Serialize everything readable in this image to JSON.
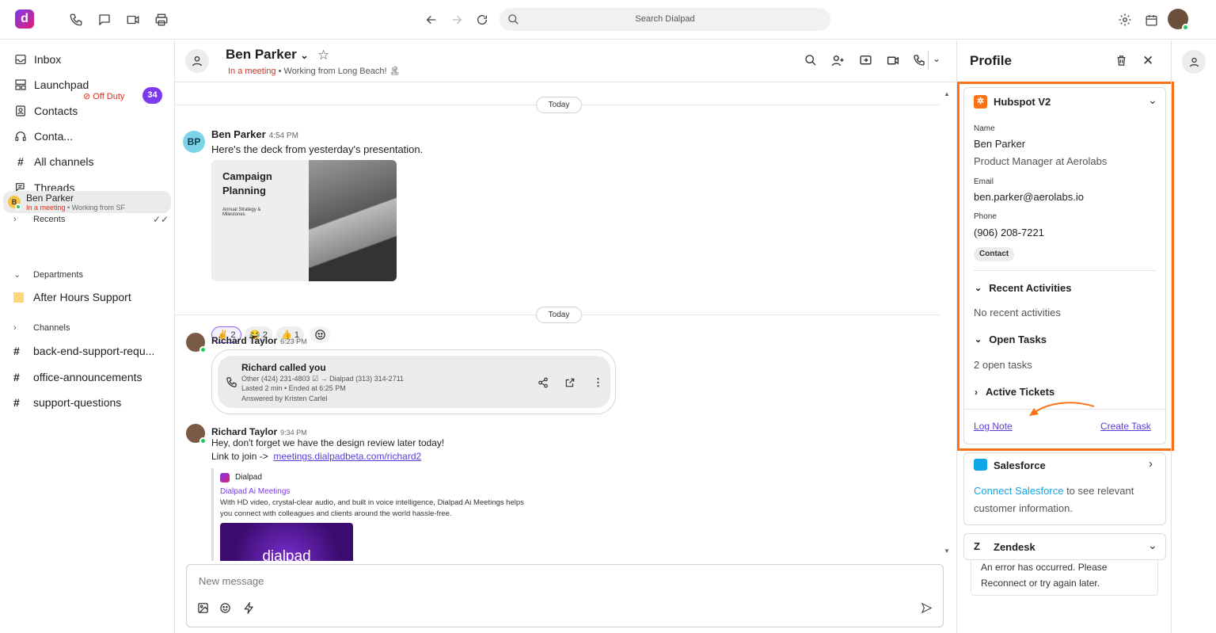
{
  "top": {
    "search_placeholder": "Search Dialpad"
  },
  "sidebar": {
    "nav": [
      {
        "label": "Inbox",
        "icon": "inbox-icon"
      },
      {
        "label": "Launchpad",
        "icon": "launchpad-icon"
      },
      {
        "label": "Contacts",
        "icon": "contacts-icon"
      },
      {
        "label": "Conta...",
        "icon": "headset-icon"
      },
      {
        "label": "All channels",
        "icon": "hash-icon"
      },
      {
        "label": "Threads",
        "icon": "threads-icon"
      }
    ],
    "off_duty": "Off Duty",
    "badge": "34",
    "recents_label": "Recents",
    "recent": {
      "initial": "B",
      "name": "Ben Parker",
      "status": "In a meeting",
      "sub": " • Working from SF"
    },
    "departments_label": "Departments",
    "department": "After Hours Support",
    "channels_label": "Channels",
    "channels": [
      "back-end-support-requ...",
      "office-announcements",
      "support-questions"
    ]
  },
  "chat": {
    "header": {
      "name": "Ben Parker",
      "status": "In a meeting",
      "sub": " • Working from Long Beach! 🏝"
    },
    "date1": "Today",
    "date2": "Today",
    "m1": {
      "initials": "BP",
      "name": "Ben Parker",
      "time": "4:54 PM",
      "text": "Here's the deck from yesterday's presentation.",
      "deck_title": "Campaign Planning",
      "deck_sub": "Annual Strategy & Milestones"
    },
    "reactions": [
      {
        "emoji": "✌",
        "count": "2"
      },
      {
        "emoji": "😂",
        "count": "2"
      },
      {
        "emoji": "👍",
        "count": "1"
      }
    ],
    "m2": {
      "name": "Richard Taylor",
      "time": "6:23 PM",
      "call_title": "Richard called you",
      "call_from": "Other (424) 231-4803",
      "call_to": "Dialpad (313) 314-2711",
      "call_meta": "Lasted 2 min • Ended at 6:25 PM",
      "call_answered": "Answered by Kristen Carlel"
    },
    "m3": {
      "name": "Richard Taylor",
      "time": "9:34 PM",
      "line1": "Hey, don't forget we have the design review later today!",
      "line2": "Link to join ->",
      "link": "meetings.dialpadbeta.com/richard2",
      "preview_site": "Dialpad",
      "preview_title": "Dialpad Ai Meetings",
      "preview_desc": "With HD video, crystal-clear audio, and built in voice intelligence, Dialpad Ai Meetings helps you connect with colleagues and clients around the world hassle-free.",
      "preview_img_text": "dialpad"
    },
    "composer_placeholder": "New message"
  },
  "profile": {
    "title": "Profile",
    "hubspot": {
      "title": "Hubspot V2",
      "name_label": "Name",
      "name": "Ben Parker",
      "role": "Product Manager at Aerolabs",
      "email_label": "Email",
      "email": "ben.parker@aerolabs.io",
      "phone_label": "Phone",
      "phone": "(906) 208-7221",
      "tag": "Contact",
      "recent_activities": "Recent Activities",
      "no_recent": "No recent activities",
      "open_tasks": "Open Tasks",
      "open_tasks_count": "2 open tasks",
      "active_tickets": "Active Tickets",
      "log_note": "Log Note",
      "create_task": "Create Task"
    },
    "salesforce": {
      "title": "Salesforce",
      "connect": "Connect Salesforce",
      "rest": " to see relevant customer information."
    },
    "zendesk": {
      "title": "Zendesk",
      "error": "An error has occurred. Please Reconnect or try again later."
    }
  },
  "colors": {
    "accent": "#7c3aed",
    "highlight": "#f97316",
    "danger": "#d92d20"
  }
}
